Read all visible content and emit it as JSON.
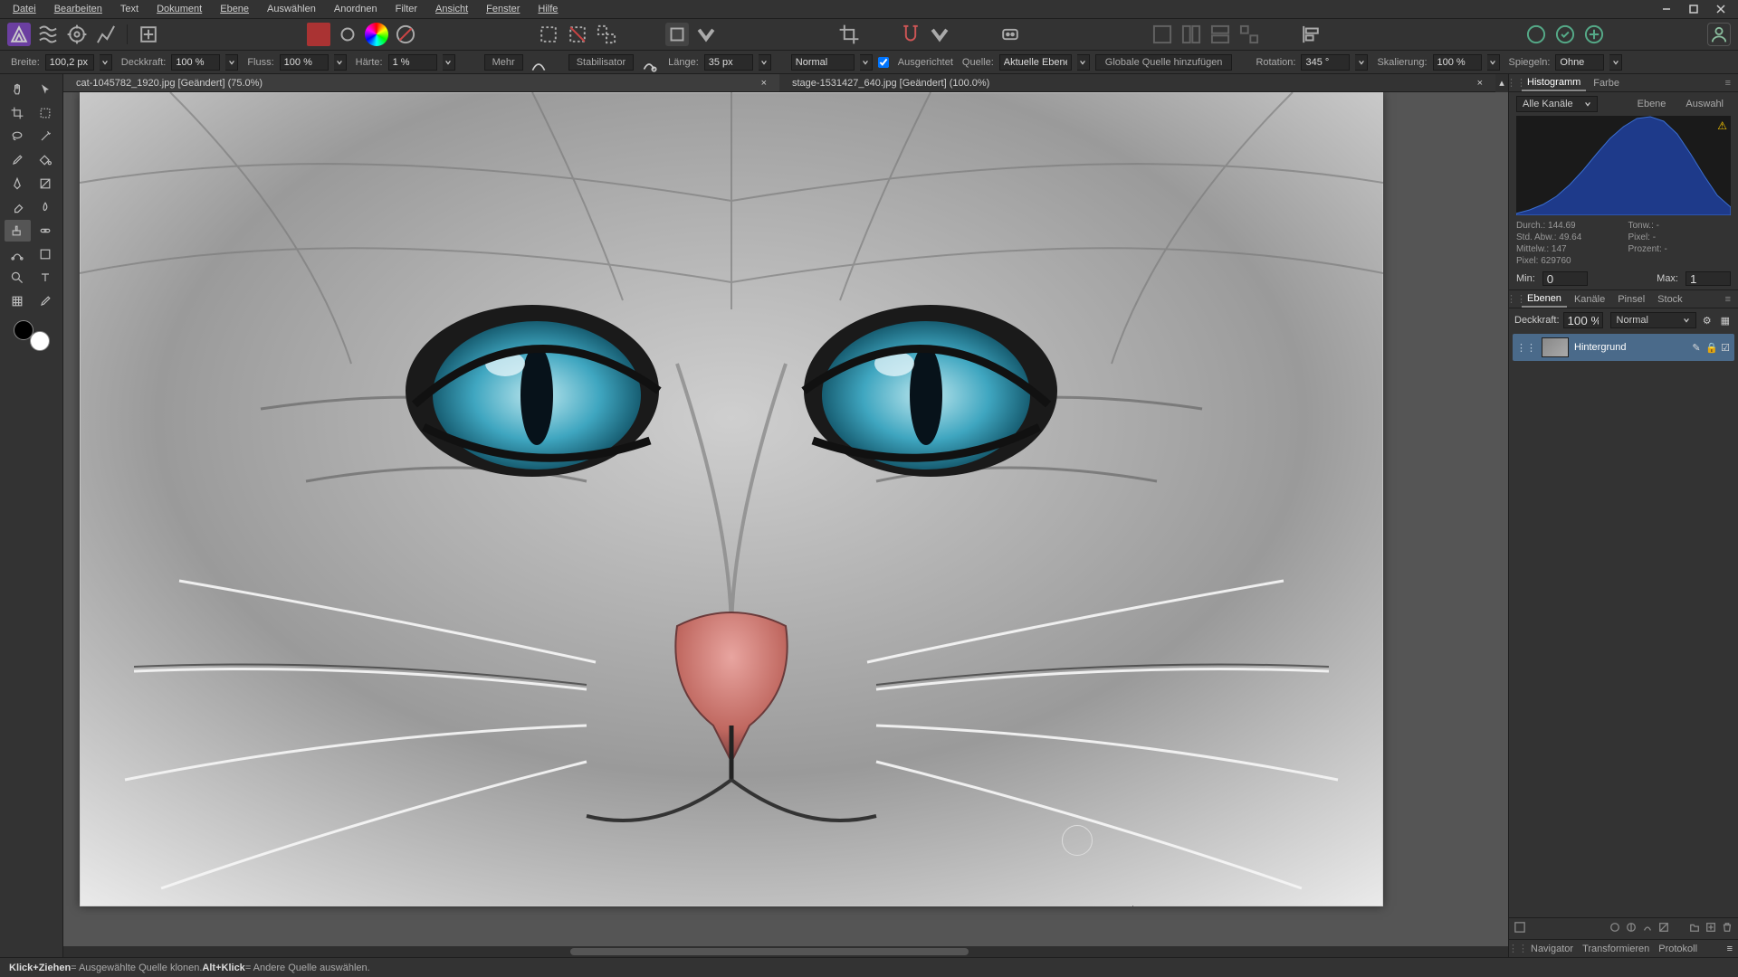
{
  "menu": {
    "items": [
      "Datei",
      "Bearbeiten",
      "Text",
      "Dokument",
      "Ebene",
      "Auswählen",
      "Anordnen",
      "Filter",
      "Ansicht",
      "Fenster",
      "Hilfe"
    ],
    "underline": [
      0,
      0,
      null,
      0,
      0,
      null,
      1,
      null,
      0,
      0,
      0
    ]
  },
  "context": {
    "breite_label": "Breite:",
    "breite": "100,2 px",
    "deckkraft_label": "Deckkraft:",
    "deckkraft": "100 %",
    "fluss_label": "Fluss:",
    "fluss": "100 %",
    "haerte_label": "Härte:",
    "haerte": "1 %",
    "mehr": "Mehr",
    "stabilisator": "Stabilisator",
    "laenge_label": "Länge:",
    "laenge": "35 px",
    "blend": "Normal",
    "ausgerichtet": "Ausgerichtet",
    "quelle_label": "Quelle:",
    "quelle": "Aktuelle Ebene",
    "globale_quelle": "Globale Quelle hinzufügen",
    "rotation_label": "Rotation:",
    "rotation": "345 °",
    "skalierung_label": "Skalierung:",
    "skalierung": "100 %",
    "spiegeln_label": "Spiegeln:",
    "spiegeln": "Ohne"
  },
  "tabs": {
    "t1": "cat-1045782_1920.jpg [Geändert] (75.0%)",
    "t2": "stage-1531427_640.jpg [Geändert] (100.0%)"
  },
  "histogram": {
    "tab1": "Histogramm",
    "tab2": "Farbe",
    "channels": "Alle Kanäle",
    "btn_ebene": "Ebene",
    "btn_auswahl": "Auswahl",
    "durch_label": "Durch.:",
    "durch": "144.69",
    "tonw_label": "Tonw.:",
    "tonw": "-",
    "stdabw_label": "Std. Abw.:",
    "stdabw": "49.64",
    "pixel2_label": "Pixel:",
    "pixel2": "-",
    "mittelw_label": "Mittelw.:",
    "mittelw": "147",
    "prozent_label": "Prozent:",
    "prozent": "-",
    "pixel_label": "Pixel:",
    "pixel": "629760",
    "min_label": "Min:",
    "min": "0",
    "max_label": "Max:",
    "max": "1"
  },
  "layers_tabs": {
    "t1": "Ebenen",
    "t2": "Kanäle",
    "t3": "Pinsel",
    "t4": "Stock"
  },
  "layers": {
    "deckkraft_label": "Deckkraft:",
    "deckkraft": "100 %",
    "blend": "Normal",
    "items": [
      {
        "name": "Hintergrund"
      }
    ]
  },
  "bottom_tabs": {
    "t1": "Navigator",
    "t2": "Transformieren",
    "t3": "Protokoll"
  },
  "status": {
    "a1": "Klick+Ziehen",
    "a2": " = Ausgewählte Quelle klonen. ",
    "b1": "Alt+Klick",
    "b2": " = Andere Quelle auswählen."
  },
  "chart_data": {
    "type": "area",
    "title": "Histogramm",
    "xlabel": "",
    "ylabel": "",
    "xlim": [
      0,
      255
    ],
    "ylim": [
      0,
      1
    ],
    "categories": [
      0,
      16,
      32,
      48,
      64,
      80,
      96,
      112,
      128,
      144,
      160,
      176,
      192,
      208,
      224,
      240,
      255
    ],
    "values": [
      0.02,
      0.05,
      0.1,
      0.18,
      0.3,
      0.45,
      0.62,
      0.78,
      0.9,
      0.98,
      1.0,
      0.95,
      0.82,
      0.62,
      0.4,
      0.2,
      0.08
    ]
  }
}
